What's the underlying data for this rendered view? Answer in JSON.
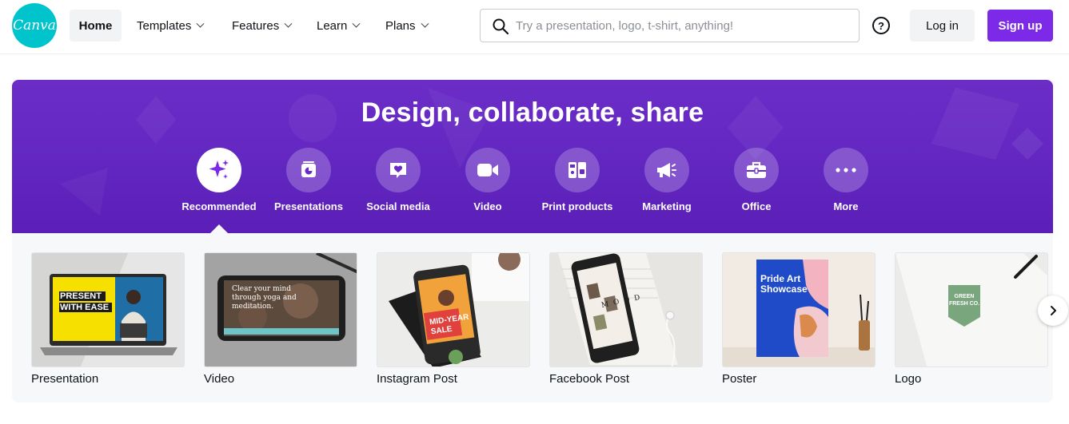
{
  "brand": {
    "logo_text": "Canva",
    "accent": "#7d2ae8",
    "logo_color": "#00c4cc"
  },
  "nav": {
    "home": "Home",
    "items": [
      {
        "label": "Templates"
      },
      {
        "label": "Features"
      },
      {
        "label": "Learn"
      },
      {
        "label": "Plans"
      }
    ]
  },
  "search": {
    "placeholder": "Try a presentation, logo, t-shirt, anything!",
    "value": "",
    "icon": "search-icon"
  },
  "header_actions": {
    "help_icon": "help-circle-icon",
    "help_glyph": "?",
    "login": "Log in",
    "signup": "Sign up"
  },
  "hero": {
    "title": "Design, collaborate, share",
    "categories": [
      {
        "label": "Recommended",
        "icon": "sparkle-icon",
        "active": true
      },
      {
        "label": "Presentations",
        "icon": "presentation-icon",
        "active": false
      },
      {
        "label": "Social media",
        "icon": "heart-chat-icon",
        "active": false
      },
      {
        "label": "Video",
        "icon": "video-camera-icon",
        "active": false
      },
      {
        "label": "Print products",
        "icon": "print-products-icon",
        "active": false
      },
      {
        "label": "Marketing",
        "icon": "megaphone-icon",
        "active": false
      },
      {
        "label": "Office",
        "icon": "briefcase-icon",
        "active": false
      },
      {
        "label": "More",
        "icon": "more-dots-icon",
        "active": false
      }
    ]
  },
  "designs": [
    {
      "title": "Presentation",
      "thumb_text": "PRESENT WITH EASE"
    },
    {
      "title": "Video",
      "thumb_text": "Clear your mind through yoga and meditation."
    },
    {
      "title": "Instagram Post",
      "thumb_text": "MID-YEAR SALE"
    },
    {
      "title": "Facebook Post",
      "thumb_text": "MOOD"
    },
    {
      "title": "Poster",
      "thumb_text": "Pride Art Showcase"
    },
    {
      "title": "Logo",
      "thumb_text": "GREEN FRESH CO."
    }
  ],
  "carousel": {
    "next_icon": "chevron-right-icon"
  }
}
